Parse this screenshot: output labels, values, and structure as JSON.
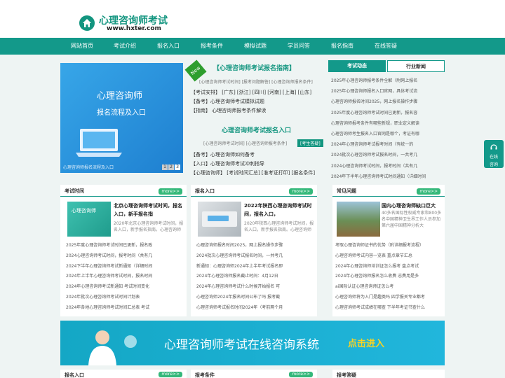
{
  "site": {
    "title": "心理咨询师考试",
    "url": "www.hxter.com"
  },
  "nav": [
    "网站首页",
    "考试介绍",
    "报名入口",
    "报考条件",
    "模拟试题",
    "学员问答",
    "报名指南",
    "在线答疑"
  ],
  "banner": {
    "line1": "心理咨询师",
    "line2": "报名流程及入口",
    "caption": "心理咨询师报名流程及入口",
    "dots": [
      "1",
      "2",
      "3"
    ]
  },
  "center": {
    "badge": "New",
    "h1": "【心理咨询师考试报名指南】",
    "links1": "[心理咨询师考试时间]  [报考问题解答]  [心理咨询师报名条件]",
    "r1": "【考试安排】 [广东] [浙江] [四川] [河南] [上海] [山东]",
    "r2": "【备考】心理咨询师考试模拟试题",
    "r3": "【指南】 心理咨询师报考条件解读",
    "h2": "心理咨询师考试报名入口",
    "links2": "[心理咨询师考试时间]  [心理咨询师报考条件]",
    "btn": "[考生答疑]",
    "r4": "【备考】心理咨询师如何备考",
    "r5": "【入口】心理咨询师考试冲刺指导",
    "r6": "【心理咨询师】 [考试时间汇总] [准考证打印] [报名条件]"
  },
  "news": {
    "tabs": [
      "考试动态",
      "行业新闻"
    ],
    "items": [
      "2025年心理咨询师报考条件全解（附网上报名",
      "2025年心理咨询师报名入口官网，具体考试流",
      "心理咨询师报名时间2025，网上报名操作步骤",
      "2025年度心理咨询师考试时间已更新，报名容",
      "心理咨询师报考条件有哪些新规，职业定义解读",
      "心理咨询师考生报名入口官网是哪个，考证有哪",
      "2024年心理咨询师考试报考时间（有统一的",
      "2024批次心理咨询师考试报名时间，一共考几",
      "2024心理咨询师考试时间，报考时间（共有几",
      "2024年下半年心理咨询师考试时间通知（详细时间"
    ]
  },
  "float": {
    "l1": "在线",
    "l2": "咨询"
  },
  "col1": {
    "title": "考试时间",
    "more": "more>>",
    "thumb": "心理咨询师",
    "ftitle": "北京心理咨询师考试时间，报名入口，新手报名指",
    "fdesc": "2020年北京心理咨询师考试时间，报名入口，新手报名指南。心理咨询师",
    "items": [
      "2025年度心理咨询师考试时间已更新，报名政",
      "2024心理咨询师考试时间，报考时间（共有几",
      "2024下半年心理咨询师考试新通知（详细时间",
      "2024年上半年心理咨询师考试时间，报名时间",
      "2024年心理咨询师考试新通知 考试时间变化",
      "2024年批次心理咨询师考试时间计划表",
      "2024年各地心理咨询师考试时间汇总表 考试"
    ]
  },
  "col2": {
    "title": "报名入口",
    "more": "more>>",
    "ftitle": "2022年陕西心理咨询师考试时间，报名入口，",
    "fdesc": "2020年陕西心理咨询师考试时间，报名入口，新手报名指南。心理咨询师",
    "items": [
      "心理咨询师报名时间2025，网上报名操作步骤",
      "2024批次心理咨询师考试报名时间，一共考几",
      "新通知：心理咨询师2024年上半年考试报名即",
      "2024年心理咨询师报名截止时间：4月12日",
      "2024年心理咨询师考试什么时候开始报名 可",
      "心理咨询师2024年报名时间公布了吗 报考截",
      "心理咨询师考试报名时间2024年（考前两个月"
    ]
  },
  "col3": {
    "title": "常见问题",
    "more": "more>>",
    "ftitle": "国内心理咨询师缺口巨大",
    "fdesc": "40多名国际性权威专家和800多名中国精神卫生界工作人员参加第六届中国精神分析大",
    "items": [
      "考取心理咨询师证书的优势（附详细报考流程）",
      "心理咨询师考试内容一览表 重点章节汇总",
      "2024年心理咨询师培训证怎么报考 盘点考试",
      "2024年心理咨询师报名怎么收费 志费用是多",
      "ai国际认证心理咨询师证怎么考",
      "心理咨询师将为入门是趣类吗 四学报关专业都考",
      "心理咨询师考试成绩在哪查 下半年考证书查什么"
    ]
  },
  "consult": {
    "text": "心理咨询师考试在线咨询系统",
    "btn": "点击进入"
  },
  "bottom": [
    {
      "title": "报名入口",
      "more": "more>>"
    },
    {
      "title": "报考条件",
      "more": "more>>"
    },
    {
      "title": "报考答疑",
      "more": ""
    }
  ],
  "colors": {
    "primary": "#13998a",
    "accent": "#34b87a"
  }
}
